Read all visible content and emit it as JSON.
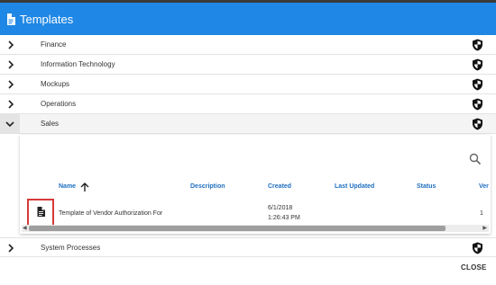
{
  "dialog": {
    "title": "Templates",
    "close_label": "CLOSE"
  },
  "categories": [
    {
      "label": "Finance"
    },
    {
      "label": "Information Technology"
    },
    {
      "label": "Mockups"
    },
    {
      "label": "Operations"
    },
    {
      "label": "Sales"
    },
    {
      "label": "System Processes"
    }
  ],
  "sales_table": {
    "columns": [
      "Name",
      "Description",
      "Created",
      "Last Updated",
      "Status",
      "Ver"
    ],
    "sort_column": "Name",
    "row": {
      "name": "Template of Vendor Authorization For",
      "description": "",
      "created_date": "6/1/2018",
      "created_time": "1:26:43 PM",
      "last_updated": "",
      "status": "",
      "version": "1"
    }
  },
  "colors": {
    "titlebar": "#1f87e5",
    "highlight": "#d63a3a",
    "link": "#1f6fc0"
  }
}
